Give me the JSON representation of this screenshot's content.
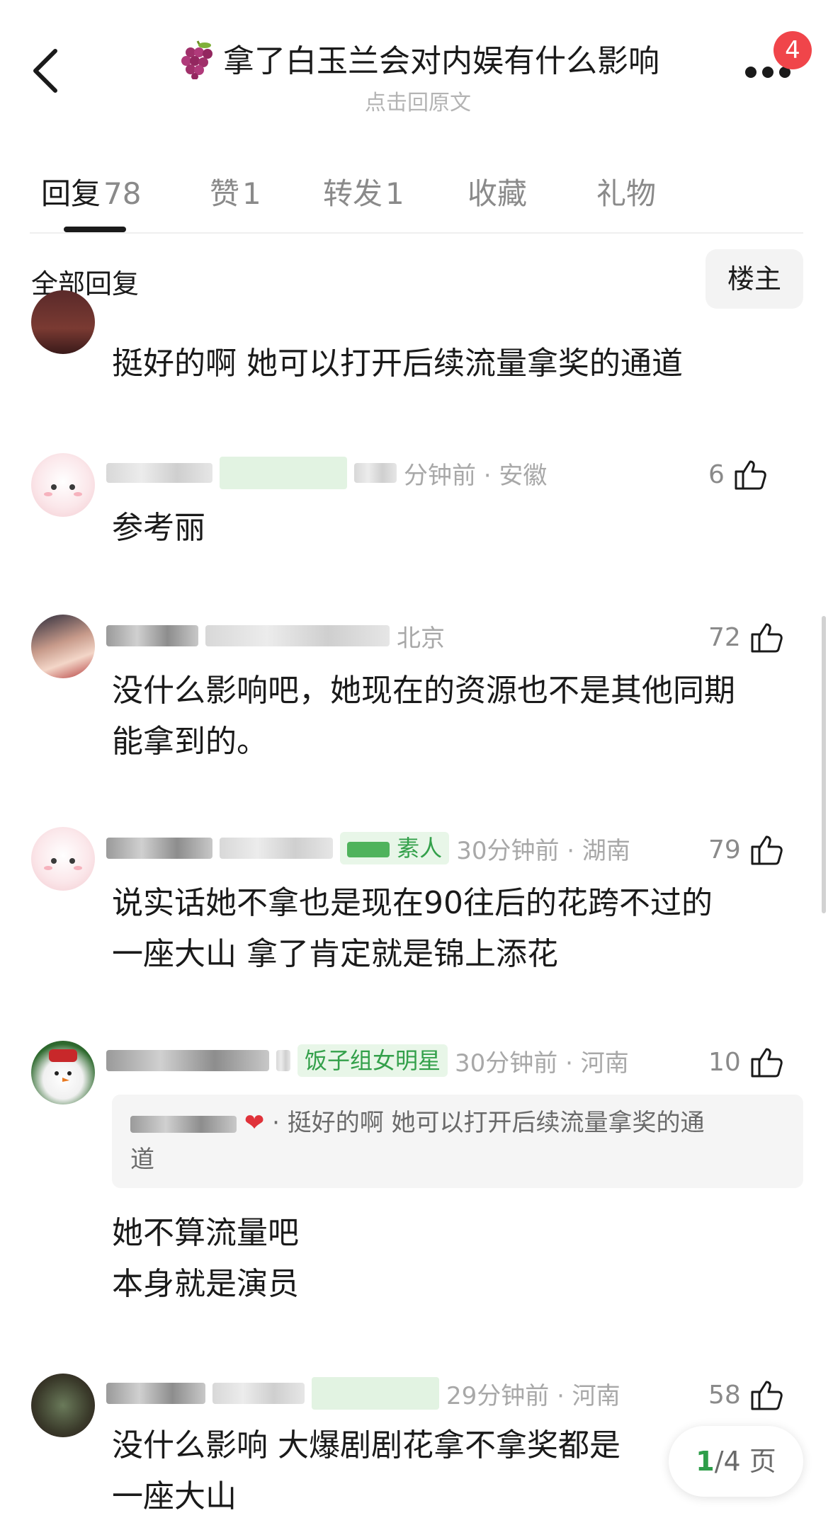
{
  "header": {
    "title": "拿了白玉兰会对内娱有什么影响",
    "subtitle": "点击回原文",
    "badge": "4",
    "title_icon": "grape-icon"
  },
  "tabs": [
    {
      "label": "回复",
      "count": "78",
      "active": true
    },
    {
      "label": "赞",
      "count": "1",
      "active": false
    },
    {
      "label": "转发",
      "count": "1",
      "active": false
    },
    {
      "label": "收藏",
      "count": "",
      "active": false
    },
    {
      "label": "礼物",
      "count": "",
      "active": false
    }
  ],
  "filter": {
    "label": "全部回复",
    "op_button": "楼主"
  },
  "comments": [
    {
      "text": "挺好的啊 她可以打开后续流量拿奖的通道"
    },
    {
      "meta_visible": "分钟前 · 安徽",
      "likes": "6",
      "text": "参考丽"
    },
    {
      "meta_visible": "北京",
      "likes": "72",
      "text_line1": "没什么影响吧，她现在的资源也不是其他同期",
      "text_line2": "能拿到的。"
    },
    {
      "tag": "素人",
      "time": "30分钟前 · 湖南",
      "likes": "79",
      "text_line1": "说实话她不拿也是现在90往后的花跨不过的",
      "text_line2": "一座大山 拿了肯定就是锦上添花"
    },
    {
      "tag": "饭子组女明星",
      "time": "30分钟前 · 河南",
      "likes": "10",
      "quote_line1": "挺好的啊 她可以打开后续流量拿奖的通",
      "quote_line2": "道",
      "text_line1": "她不算流量吧",
      "text_line2": "本身就是演员"
    },
    {
      "time": "29分钟前 · 河南",
      "likes": "58",
      "text_line1": "没什么影响 大爆剧剧花拿不拿奖都是",
      "text_line2": "一座大山"
    }
  ],
  "pager": {
    "current": "1",
    "total": "/4 页"
  },
  "colors": {
    "accent_green": "#33a04a",
    "badge_red": "#f0454a",
    "text": "#1a1a1a",
    "muted": "#a8a8a8"
  }
}
